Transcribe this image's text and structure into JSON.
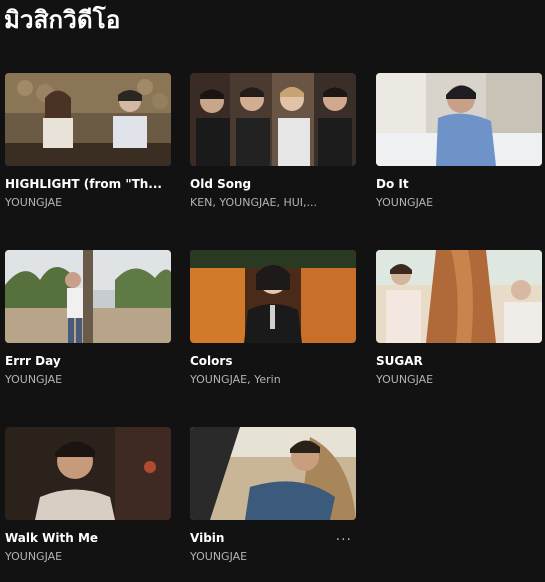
{
  "section": {
    "title": "มิวสิกวิดีโอ"
  },
  "videos": [
    {
      "title": "HIGHLIGHT (from \"Th...",
      "artist": "YOUNGJAE"
    },
    {
      "title": "Old Song",
      "artist": "KEN, YOUNGJAE, HUI,..."
    },
    {
      "title": "Do It",
      "artist": "YOUNGJAE"
    },
    {
      "title": "Errr Day",
      "artist": "YOUNGJAE"
    },
    {
      "title": "Colors",
      "artist": "YOUNGJAE, Yerin"
    },
    {
      "title": "SUGAR",
      "artist": "YOUNGJAE"
    },
    {
      "title": "Walk With Me",
      "artist": "YOUNGJAE"
    },
    {
      "title": "Vibin",
      "artist": "YOUNGJAE",
      "more_label": "···"
    }
  ]
}
